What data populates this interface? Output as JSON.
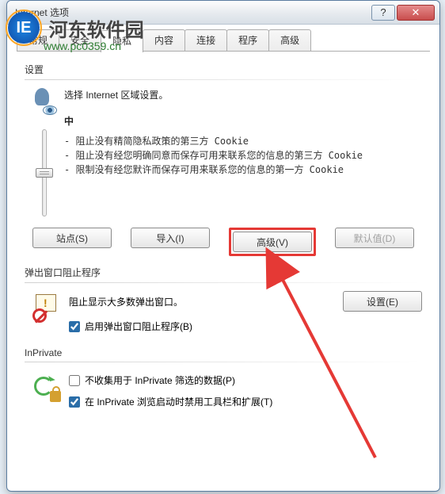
{
  "watermark": {
    "logo": "IE",
    "text": "河东软件园",
    "url": "www.pc0359.cn"
  },
  "dialog": {
    "title": "Internet 选项",
    "tabs": [
      "常规",
      "安全",
      "隐私",
      "内容",
      "连接",
      "程序",
      "高级"
    ],
    "active_tab_index": 2
  },
  "settings": {
    "group_label": "设置",
    "select_zone": "选择 Internet 区域设置。",
    "level_name": "中",
    "policies": [
      "- 阻止没有精简隐私政策的第三方 Cookie",
      "- 阻止没有经您明确同意而保存可用来联系您的信息的第三方 Cookie",
      "- 限制没有经您默许而保存可用来联系您的信息的第一方 Cookie"
    ],
    "buttons": {
      "sites": "站点(S)",
      "import": "导入(I)",
      "advanced": "高级(V)",
      "default": "默认值(D)"
    }
  },
  "popup": {
    "group_label": "弹出窗口阻止程序",
    "desc": "阻止显示大多数弹出窗口。",
    "settings_btn": "设置(E)",
    "checkbox": "启用弹出窗口阻止程序(B)"
  },
  "inprivate": {
    "group_label": "InPrivate",
    "chk1": "不收集用于 InPrivate 筛选的数据(P)",
    "chk2": "在 InPrivate 浏览启动时禁用工具栏和扩展(T)"
  },
  "highlight_color": "#e53935"
}
